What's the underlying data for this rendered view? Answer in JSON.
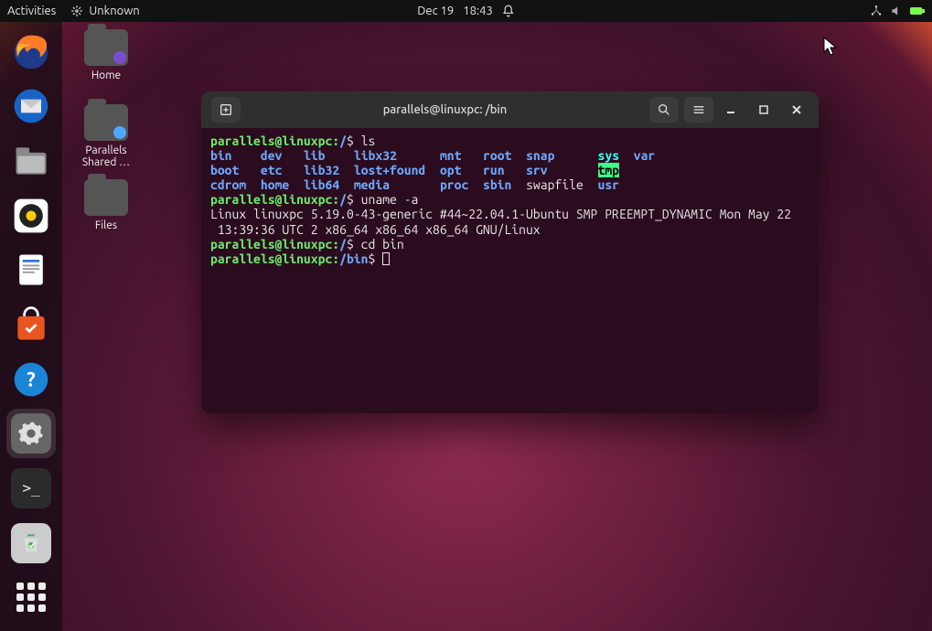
{
  "topbar": {
    "activities": "Activities",
    "app_indicator": "Unknown",
    "date": "Dec 19",
    "time": "18:43"
  },
  "desktop": {
    "home": "Home",
    "parallels": "Parallels Shared …",
    "files": "Files"
  },
  "dock": {
    "firefox": "Firefox",
    "thunderbird": "Thunderbird",
    "files": "Files",
    "rhythmbox": "Rhythmbox",
    "writer": "LibreOffice Writer",
    "software": "Ubuntu Software",
    "help": "Help",
    "settings": "Settings",
    "terminal": "Terminal",
    "trash": "Trash",
    "apps": "Show Applications"
  },
  "terminal": {
    "title": "parallels@linuxpc: /bin",
    "prompt_user": "parallels@linuxpc",
    "prompt_sep": ":",
    "path_root": "/",
    "path_bin": "/bin",
    "dollar": "$",
    "cmd_ls": "ls",
    "cmd_uname": "uname -a",
    "cmd_cd": "cd bin",
    "uname_out1": "Linux linuxpc 5.19.0-43-generic #44~22.04.1-Ubuntu SMP PREEMPT_DYNAMIC Mon May 22",
    "uname_out2": " 13:39:36 UTC 2 x86_64 x86_64 x86_64 GNU/Linux",
    "ls": {
      "r1": [
        "bin",
        "dev",
        "lib",
        "libx32",
        "mnt",
        "root",
        "snap",
        "sys",
        "var"
      ],
      "r2": [
        "boot",
        "etc",
        "lib32",
        "lost+found",
        "opt",
        "run",
        "srv",
        "tmp"
      ],
      "r3": [
        "cdrom",
        "home",
        "lib64",
        "media",
        "proc",
        "sbin",
        "swapfile",
        "usr"
      ]
    }
  }
}
